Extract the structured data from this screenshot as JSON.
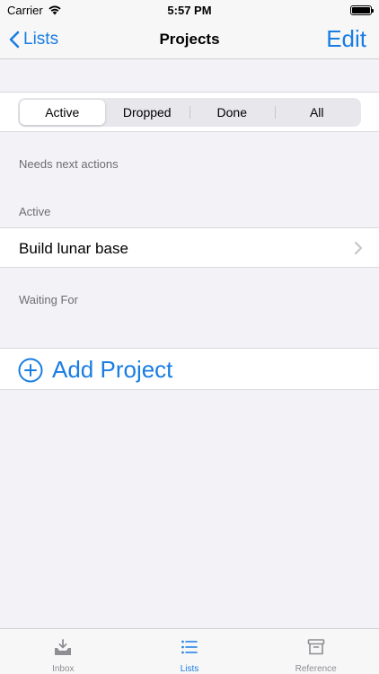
{
  "status_bar": {
    "carrier": "Carrier",
    "time": "5:57 PM"
  },
  "nav": {
    "back_label": "Lists",
    "title": "Projects",
    "edit_label": "Edit"
  },
  "segments": [
    {
      "label": "Active",
      "selected": true
    },
    {
      "label": "Dropped",
      "selected": false
    },
    {
      "label": "Done",
      "selected": false
    },
    {
      "label": "All",
      "selected": false
    }
  ],
  "sections": {
    "needs_next_actions": "Needs next actions",
    "active": "Active",
    "waiting_for": "Waiting For"
  },
  "projects": [
    {
      "title": "Build lunar base"
    }
  ],
  "add_project_label": "Add Project",
  "tabs": [
    {
      "label": "Inbox",
      "icon": "inbox-icon",
      "selected": false
    },
    {
      "label": "Lists",
      "icon": "list-icon",
      "selected": true
    },
    {
      "label": "Reference",
      "icon": "archive-icon",
      "selected": false
    }
  ],
  "colors": {
    "accent": "#1a7de2",
    "background": "#f2f2f7",
    "inactive_tab": "#8e8e93"
  }
}
